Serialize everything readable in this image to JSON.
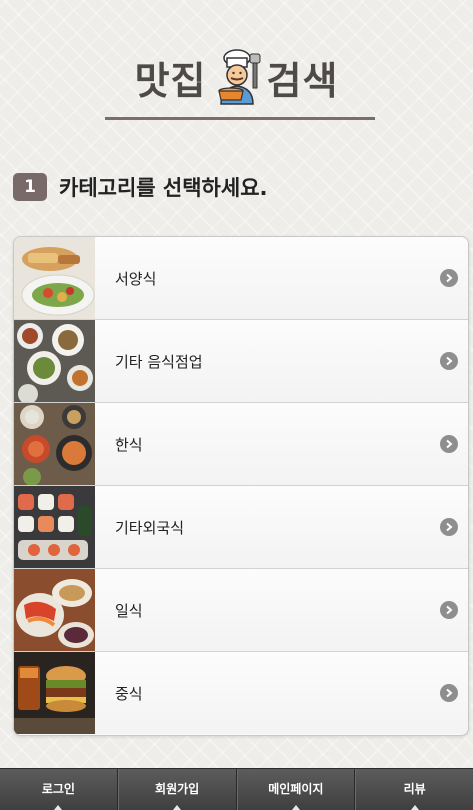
{
  "header": {
    "title_left": "맛집",
    "title_right": "검색",
    "logo_icon": "chef-icon"
  },
  "step": {
    "number": "1",
    "text": "카테고리를 선택하세요."
  },
  "categories": [
    {
      "label": "서양식",
      "icon": "chevron-right-icon"
    },
    {
      "label": "기타 음식점업",
      "icon": "chevron-right-icon"
    },
    {
      "label": "한식",
      "icon": "chevron-right-icon"
    },
    {
      "label": "기타외국식",
      "icon": "chevron-right-icon"
    },
    {
      "label": "일식",
      "icon": "chevron-right-icon"
    },
    {
      "label": "중식",
      "icon": "chevron-right-icon"
    }
  ],
  "nav": {
    "items": [
      {
        "label": "로그인"
      },
      {
        "label": "회원가입"
      },
      {
        "label": "메인페이지"
      },
      {
        "label": "리뷰"
      }
    ]
  },
  "colors": {
    "title": "#4d4a48",
    "step_badge": "#776a68",
    "nav_bg": "#4a4a4a",
    "arrow": "#8e8e8e"
  }
}
